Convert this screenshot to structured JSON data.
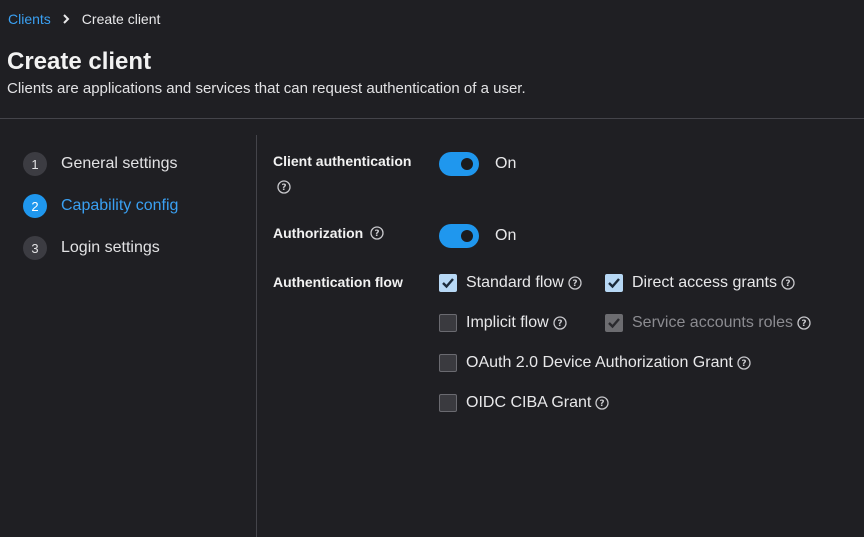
{
  "breadcrumb": {
    "parent": "Clients",
    "current": "Create client"
  },
  "header": {
    "title": "Create client",
    "description": "Clients are applications and services that can request authentication of a user."
  },
  "steps": [
    {
      "number": "1",
      "label": "General settings",
      "active": false
    },
    {
      "number": "2",
      "label": "Capability config",
      "active": true
    },
    {
      "number": "3",
      "label": "Login settings",
      "active": false
    }
  ],
  "form": {
    "client_authentication": {
      "label": "Client authentication",
      "state": "On",
      "enabled": true
    },
    "authorization": {
      "label": "Authorization",
      "state": "On",
      "enabled": true
    },
    "authentication_flow": {
      "label": "Authentication flow",
      "options": [
        {
          "label": "Standard flow",
          "checked": true,
          "disabled": false
        },
        {
          "label": "Direct access grants",
          "checked": true,
          "disabled": false
        },
        {
          "label": "Implicit flow",
          "checked": false,
          "disabled": false
        },
        {
          "label": "Service accounts roles",
          "checked": true,
          "disabled": true
        },
        {
          "label": "OAuth 2.0 Device Authorization Grant",
          "checked": false,
          "disabled": false
        },
        {
          "label": "OIDC CIBA Grant",
          "checked": false,
          "disabled": false
        }
      ]
    }
  },
  "colors": {
    "accent": "#1f97ee",
    "link": "#3aa0f2",
    "background": "#1f1f23"
  },
  "icons": {
    "help": "help-circle-icon",
    "separator": "chevron-right-icon",
    "check": "checkmark-icon"
  }
}
